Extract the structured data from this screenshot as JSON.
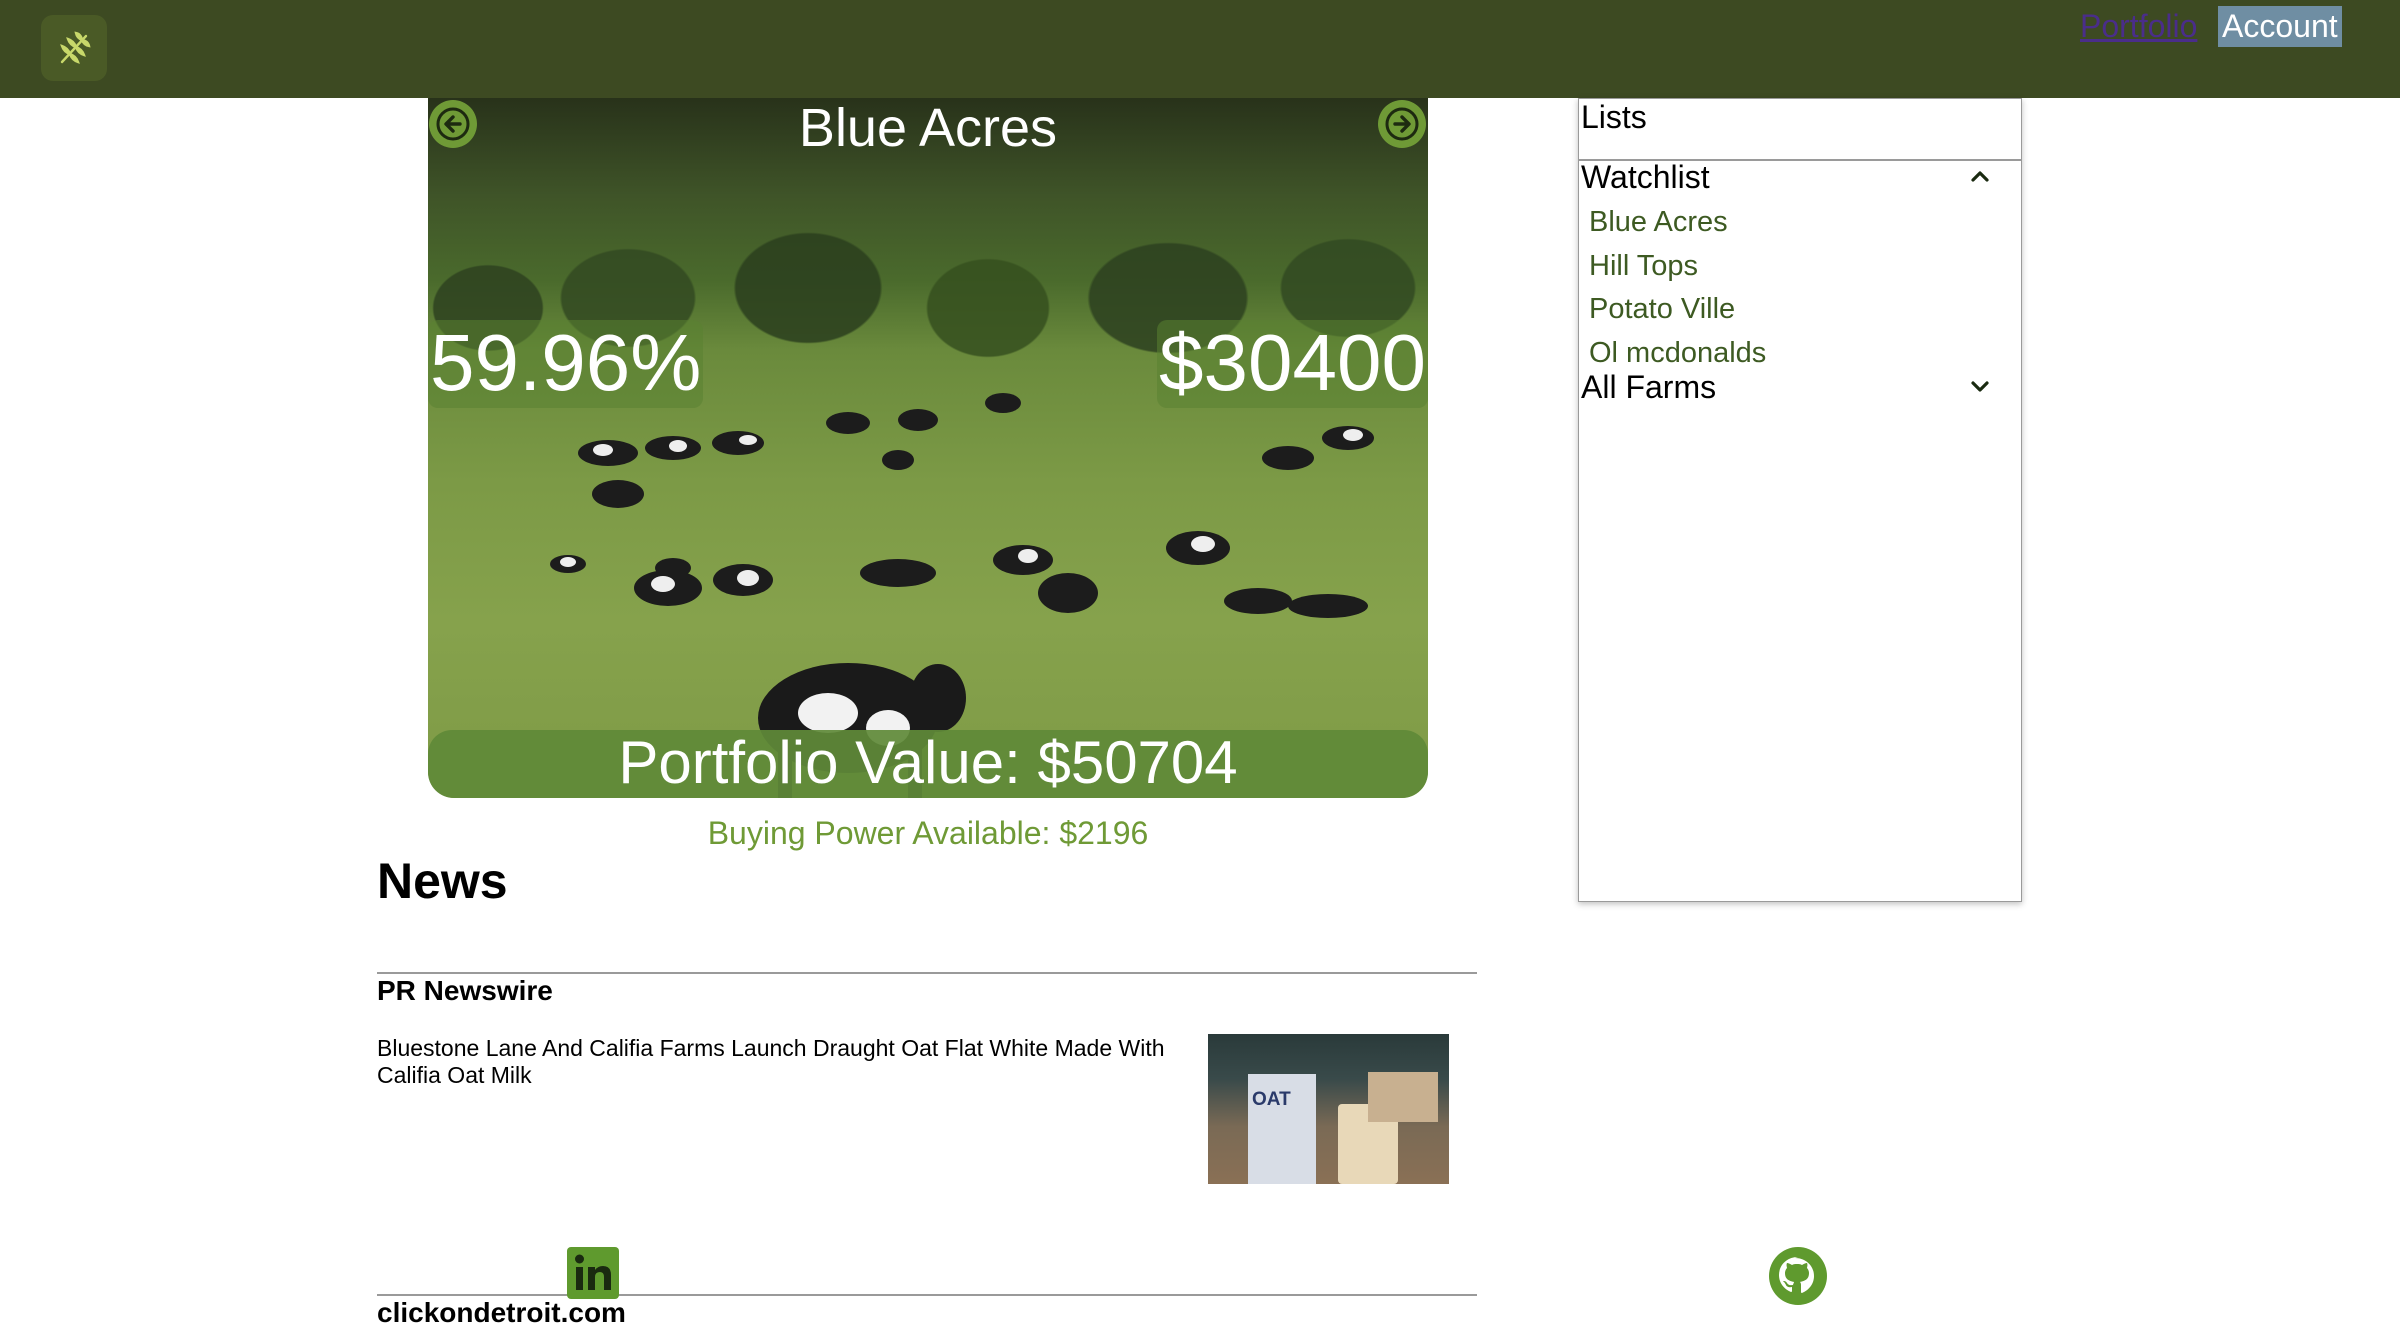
{
  "nav": {
    "portfolio_label": "Portfolio",
    "account_label": "Account"
  },
  "hero": {
    "farm_name": "Blue Acres",
    "percent": "59.96%",
    "price": "$30400",
    "portfolio_value": "Portfolio Value: $50704"
  },
  "buying_power": "Buying Power Available: $2196",
  "news": {
    "heading": "News",
    "articles": [
      {
        "source": "PR Newswire",
        "headline": "Bluestone Lane And Califia Farms Launch Draught Oat Flat White Made With Califia Oat Milk",
        "thumb_text": "OAT"
      },
      {
        "source": "clickondetroit.com"
      }
    ]
  },
  "lists": {
    "title": "Lists",
    "watchlist": {
      "label": "Watchlist",
      "items": [
        "Blue Acres",
        "Hill Tops",
        "Potato Ville",
        "Ol mcdonalds"
      ]
    },
    "all_farms": {
      "label": "All Farms"
    }
  },
  "colors": {
    "nav_bg": "#3d4a22",
    "accent_green": "#6f9a36",
    "watchlist_text": "#3d5a22"
  },
  "icons": [
    "wheat-logo-icon",
    "arrow-left-icon",
    "arrow-right-icon",
    "chevron-up-icon",
    "chevron-down-icon",
    "linkedin-icon",
    "github-icon"
  ]
}
